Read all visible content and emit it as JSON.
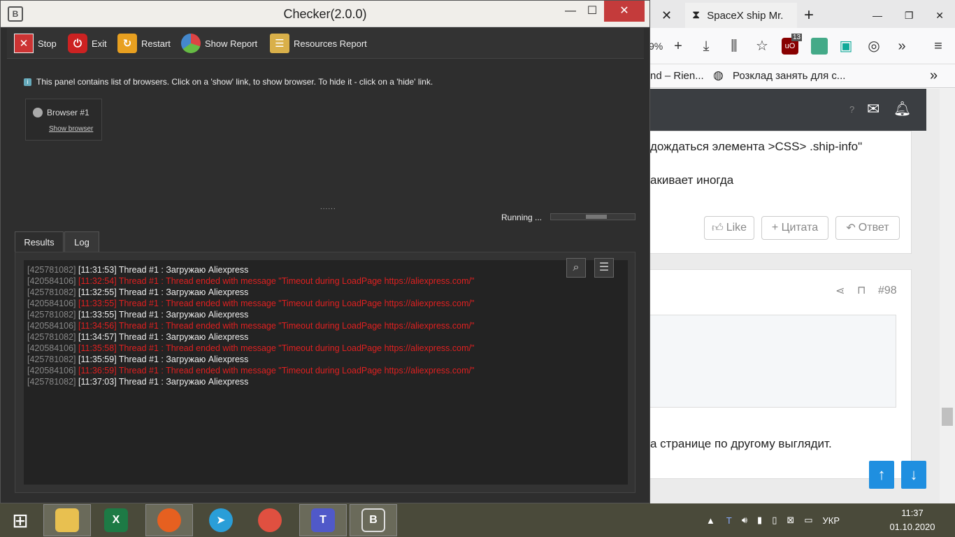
{
  "browser": {
    "tabs": [
      {
        "label": "SpaceX ship Mr."
      }
    ],
    "zoom": "9%",
    "ublock_count": "13",
    "bookmarks": [
      {
        "label": "nd – Rien..."
      },
      {
        "label": "Розклад занять для с..."
      }
    ],
    "page": {
      "header_help": "?",
      "line1": " дождаться элемента >CSS> .ship-info\"",
      "line2": "акивает иногда",
      "like_label": "Like",
      "quote_label": "+ Цитата",
      "reply_label": "Ответ",
      "post_number": "#98",
      "line3": "а странице по другому выглядит."
    }
  },
  "checker": {
    "title": "Checker(2.0.0)",
    "toolbar": {
      "stop": "Stop",
      "exit": "Exit",
      "restart": "Restart",
      "show_report": "Show Report",
      "resources_report": "Resources Report"
    },
    "panel_info": "This panel contains list of browsers. Click on a 'show' link, to show browser. To hide it - click on a 'hide' link.",
    "browser_item": {
      "name": "Browser #1",
      "link": "Show browser"
    },
    "status": "Running ...",
    "progress": 0.25,
    "tabs": [
      {
        "label": "Results",
        "active": false
      },
      {
        "label": "Log",
        "active": true
      }
    ],
    "log": [
      {
        "id": "[425781082]",
        "text": "[11:31:53] Thread #1 : Загружаю Aliexpress",
        "error": false
      },
      {
        "id": "[420584106]",
        "text": "[11:32:54] Thread #1 : Thread ended with message \"Timeout during LoadPage https://aliexpress.com/\"",
        "error": true
      },
      {
        "id": "[425781082]",
        "text": "[11:32:55] Thread #1 : Загружаю Aliexpress",
        "error": false
      },
      {
        "id": "[420584106]",
        "text": "[11:33:55] Thread #1 : Thread ended with message \"Timeout during LoadPage https://aliexpress.com/\"",
        "error": true
      },
      {
        "id": "[425781082]",
        "text": "[11:33:55] Thread #1 : Загружаю Aliexpress",
        "error": false
      },
      {
        "id": "[420584106]",
        "text": "[11:34:56] Thread #1 : Thread ended with message \"Timeout during LoadPage https://aliexpress.com/\"",
        "error": true
      },
      {
        "id": "[425781082]",
        "text": "[11:34:57] Thread #1 : Загружаю Aliexpress",
        "error": false
      },
      {
        "id": "[420584106]",
        "text": "[11:35:58] Thread #1 : Thread ended with message \"Timeout during LoadPage https://aliexpress.com/\"",
        "error": true
      },
      {
        "id": "[425781082]",
        "text": "[11:35:59] Thread #1 : Загружаю Aliexpress",
        "error": false
      },
      {
        "id": "[420584106]",
        "text": "[11:36:59] Thread #1 : Thread ended with message \"Timeout during LoadPage https://aliexpress.com/\"",
        "error": true
      },
      {
        "id": "[425781082]",
        "text": "[11:37:03] Thread #1 : Загружаю Aliexpress",
        "error": false
      }
    ]
  },
  "taskbar": {
    "language": "УКР",
    "time": "11:37",
    "date": "01.10.2020"
  },
  "colors": {
    "error": "#e02020",
    "accent": "#1f8fe0"
  }
}
